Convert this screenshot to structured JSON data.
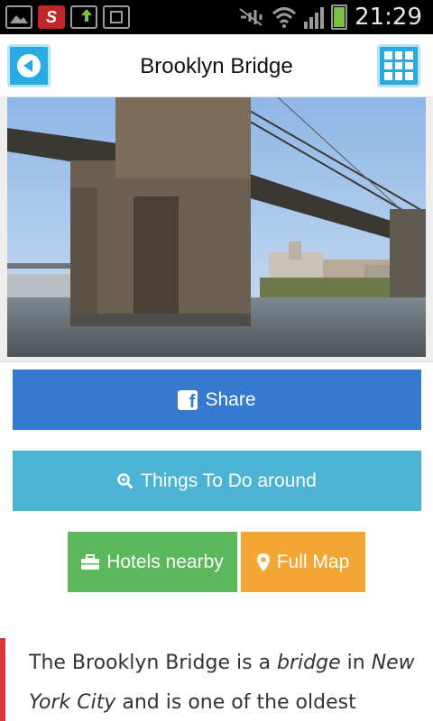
{
  "status_bar": {
    "time": "21:29",
    "icons": [
      "gallery-icon",
      "s-app-icon",
      "upload-icon",
      "sim-icon",
      "mute-icon",
      "wifi-icon",
      "signal-icon",
      "battery-icon"
    ]
  },
  "header": {
    "title": "Brooklyn Bridge",
    "back_icon": "back-arrow-icon",
    "menu_icon": "grid-menu-icon"
  },
  "actions": {
    "share_label": "Share",
    "things_label": "Things To Do around",
    "hotels_label": "Hotels nearby",
    "map_label": "Full Map"
  },
  "description": {
    "t1": "The Brooklyn Bridge is a ",
    "i1": "bridge",
    "t2": " in ",
    "i2": "New York City",
    "t3": " and is one of the oldest"
  },
  "colors": {
    "share": "#3579d0",
    "things": "#4ab4d2",
    "hotels": "#5cb85c",
    "map": "#f3a634",
    "accent": "#29abe2",
    "quote_bar": "#d9383a"
  }
}
